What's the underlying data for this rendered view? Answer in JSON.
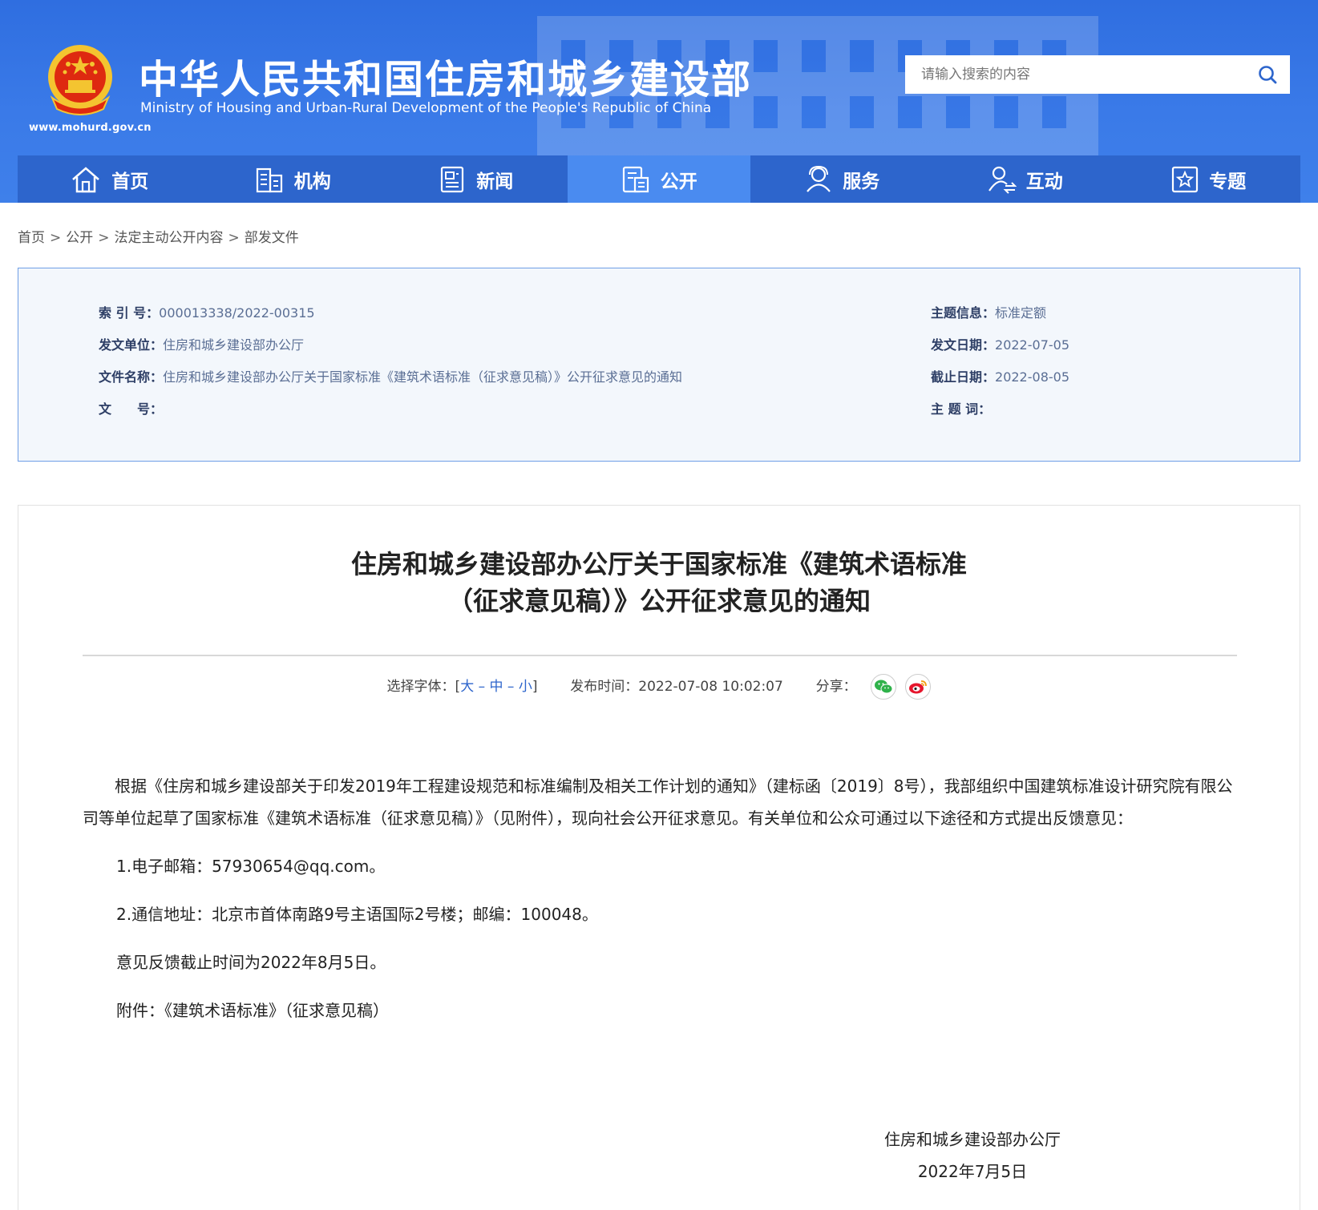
{
  "header": {
    "title": "中华人民共和国住房和城乡建设部",
    "subtitle": "Ministry of Housing and Urban-Rural Development of the People's Republic of China",
    "url": "www.mohurd.gov.cn",
    "search_placeholder": "请输入搜索的内容"
  },
  "nav": [
    {
      "label": "首页",
      "icon": "home-icon"
    },
    {
      "label": "机构",
      "icon": "building-icon"
    },
    {
      "label": "新闻",
      "icon": "newspaper-icon"
    },
    {
      "label": "公开",
      "icon": "document-icon",
      "active": true
    },
    {
      "label": "服务",
      "icon": "user-service-icon"
    },
    {
      "label": "互动",
      "icon": "user-interact-icon"
    },
    {
      "label": "专题",
      "icon": "star-icon"
    }
  ],
  "breadcrumb": [
    "首页",
    "公开",
    "法定主动公开内容",
    "部发文件"
  ],
  "meta": {
    "index_label": "索 引 号：",
    "index_value": "000013338/2022-00315",
    "issuer_label": "发文单位：",
    "issuer_value": "住房和城乡建设部办公厅",
    "docname_label": "文件名称：",
    "docname_value": "住房和城乡建设部办公厅关于国家标准《建筑术语标准（征求意见稿）》公开征求意见的通知",
    "docno_label": "文　　号：",
    "docno_value": "",
    "topic_label": "主题信息：",
    "topic_value": "标准定额",
    "date_label": "发文日期：",
    "date_value": "2022-07-05",
    "deadline_label": "截止日期：",
    "deadline_value": "2022-08-05",
    "keywords_label": "主 题 词：",
    "keywords_value": ""
  },
  "article": {
    "title_line1": "住房和城乡建设部办公厅关于国家标准《建筑术语标准",
    "title_line2": "（征求意见稿）》公开征求意见的通知",
    "font_label": "选择字体：[",
    "font_large": "大",
    "font_medium": "中",
    "font_small": "小",
    "font_close": "]",
    "publish_label": "发布时间：",
    "publish_time": "2022-07-08 10:02:07",
    "share_label": "分享：",
    "para1": "根据《住房和城乡建设部关于印发2019年工程建设规范和标准编制及相关工作计划的通知》（建标函〔2019〕8号），我部组织中国建筑标准设计研究院有限公司等单位起草了国家标准《建筑术语标准（征求意见稿）》（见附件），现向社会公开征求意见。有关单位和公众可通过以下途径和方式提出反馈意见：",
    "item1": "1.电子邮箱：57930654@qq.com。",
    "item2": "2.通信地址：北京市首体南路9号主语国际2号楼；邮编：100048。",
    "item3": "意见反馈截止时间为2022年8月5日。",
    "attach_label": "附件：",
    "attach_link": "《建筑术语标准》（征求意见稿）",
    "sign_org": "住房和城乡建设部办公厅",
    "sign_date": "2022年7月5日"
  },
  "colors": {
    "header_blue": "#2f6ee0",
    "nav_blue": "#2d65cc",
    "nav_active": "#4a8bf0",
    "link_blue": "#2d65cc"
  }
}
